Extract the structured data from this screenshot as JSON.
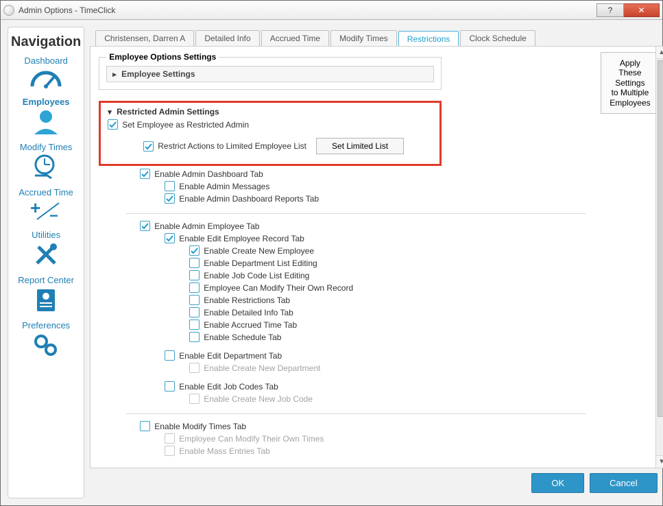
{
  "window": {
    "title": "Admin Options - TimeClick"
  },
  "title_controls": {
    "help": "?",
    "close": "✕"
  },
  "nav": {
    "title": "Navigation",
    "items": [
      {
        "label": "Dashboard",
        "icon": "gauge"
      },
      {
        "label": "Employees",
        "icon": "person",
        "active": true
      },
      {
        "label": "Modify Times",
        "icon": "clock"
      },
      {
        "label": "Accrued Time",
        "icon": "plusminus"
      },
      {
        "label": "Utilities",
        "icon": "tools"
      },
      {
        "label": "Report Center",
        "icon": "report"
      },
      {
        "label": "Preferences",
        "icon": "gears"
      }
    ]
  },
  "tabs": [
    "Christensen, Darren A",
    "Detailed Info",
    "Accrued Time",
    "Modify Times",
    "Restrictions",
    "Clock Schedule"
  ],
  "active_tab_index": 4,
  "right": {
    "apply_line1": "Apply These Settings",
    "apply_line2": "to Multiple Employees"
  },
  "group": {
    "outer_legend": "Employee Options Settings",
    "expander_label": "Employee Settings",
    "restricted_header": "Restricted Admin Settings",
    "set_restricted": "Set Employee as Restricted Admin",
    "restrict_actions": "Restrict Actions to Limited Employee List",
    "set_limited_btn": "Set Limited List"
  },
  "opts": {
    "enable_admin_dashboard_tab": {
      "label": "Enable Admin Dashboard Tab",
      "checked": true
    },
    "enable_admin_messages": {
      "label": "Enable Admin Messages",
      "checked": false
    },
    "enable_admin_dashboard_reports_tab": {
      "label": "Enable Admin Dashboard Reports Tab",
      "checked": true
    },
    "enable_admin_employee_tab": {
      "label": "Enable Admin Employee Tab",
      "checked": true
    },
    "enable_edit_employee_record_tab": {
      "label": "Enable Edit Employee Record Tab",
      "checked": true
    },
    "enable_create_new_employee": {
      "label": "Enable Create New Employee",
      "checked": true
    },
    "enable_department_list_editing": {
      "label": "Enable Department List Editing",
      "checked": false
    },
    "enable_job_code_list_editing": {
      "label": "Enable Job Code List Editing",
      "checked": false
    },
    "employee_can_modify_own_record": {
      "label": "Employee Can Modify Their Own Record",
      "checked": false
    },
    "enable_restrictions_tab": {
      "label": "Enable Restrictions Tab",
      "checked": false
    },
    "enable_detailed_info_tab": {
      "label": "Enable Detailed Info Tab",
      "checked": false
    },
    "enable_accrued_time_tab": {
      "label": "Enable Accrued Time Tab",
      "checked": false
    },
    "enable_schedule_tab": {
      "label": "Enable Schedule Tab",
      "checked": false
    },
    "enable_edit_department_tab": {
      "label": "Enable Edit Department Tab",
      "checked": false
    },
    "enable_create_new_department": {
      "label": "Enable Create New Department",
      "checked": false,
      "disabled": true
    },
    "enable_edit_job_codes_tab": {
      "label": "Enable Edit Job Codes Tab",
      "checked": false
    },
    "enable_create_new_job_code": {
      "label": "Enable Create New Job Code",
      "checked": false,
      "disabled": true
    },
    "enable_modify_times_tab": {
      "label": "Enable Modify Times Tab",
      "checked": false
    },
    "employee_can_modify_own_times": {
      "label": "Employee Can Modify Their Own Times",
      "checked": false,
      "disabled": true
    },
    "enable_mass_entries_tab": {
      "label": "Enable Mass Entries Tab",
      "checked": false,
      "disabled": true
    }
  },
  "footer": {
    "ok": "OK",
    "cancel": "Cancel"
  },
  "colors": {
    "accent": "#1f9ecf",
    "highlight": "#e03a2a",
    "primary_btn": "#2e95c8"
  }
}
